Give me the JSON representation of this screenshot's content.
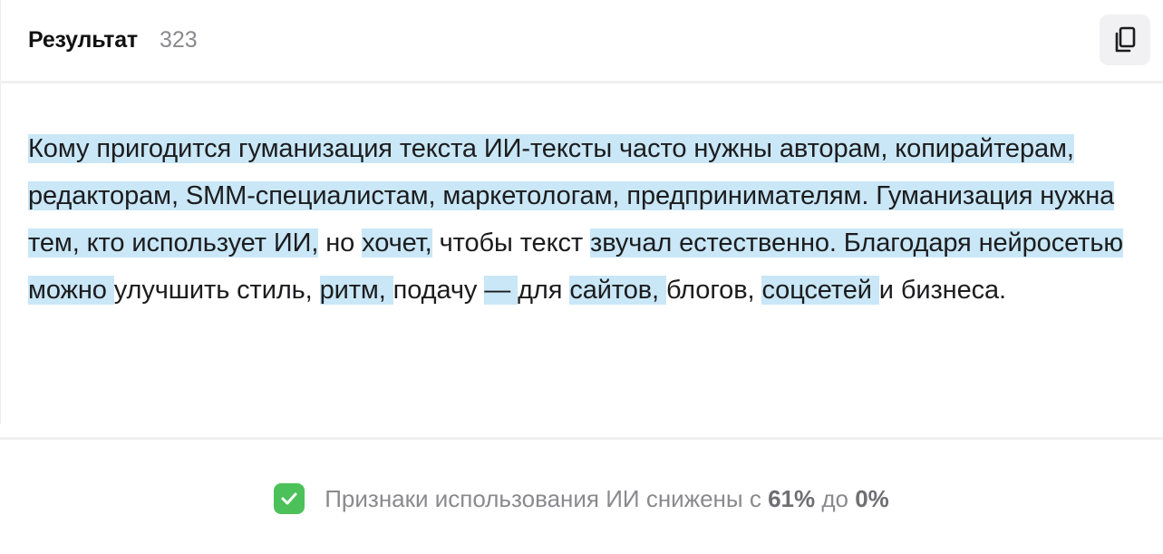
{
  "header": {
    "title": "Результат",
    "count": "323",
    "copy_icon": "copy-icon"
  },
  "result": {
    "segments": [
      {
        "text": "Кому пригодится гуманизация текста ИИ-тексты часто нужны авторам, копирайтерам, редакторам, SMM-специалистам, маркетологам, предпринимателям. Гуманизация нужна тем, кто использует ИИ,",
        "highlighted": true
      },
      {
        "text": " но ",
        "highlighted": false
      },
      {
        "text": "хочет,",
        "highlighted": true
      },
      {
        "text": " чтобы текст ",
        "highlighted": false
      },
      {
        "text": "звучал естественно. Благодаря нейросетью можно ",
        "highlighted": true
      },
      {
        "text": "улучшить стиль, ",
        "highlighted": false
      },
      {
        "text": "ритм, ",
        "highlighted": true
      },
      {
        "text": "подачу ",
        "highlighted": false
      },
      {
        "text": "— ",
        "highlighted": true
      },
      {
        "text": "для ",
        "highlighted": false
      },
      {
        "text": "сайтов, ",
        "highlighted": true
      },
      {
        "text": "блогов, ",
        "highlighted": false
      },
      {
        "text": "соцсетей ",
        "highlighted": true
      },
      {
        "text": "и бизнеса.",
        "highlighted": false
      }
    ],
    "highlight_color": "#c9e7f7"
  },
  "status": {
    "icon": "checkmark-icon",
    "icon_color": "#4cc15a",
    "prefix": "Признаки использования ИИ снижены с ",
    "from_value": "61%",
    "middle": " до ",
    "to_value": "0%"
  }
}
